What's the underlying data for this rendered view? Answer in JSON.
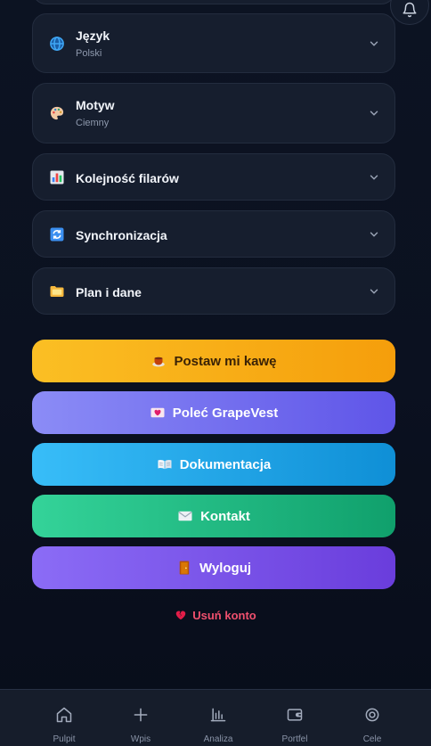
{
  "settings": {
    "language": {
      "title": "Język",
      "value": "Polski"
    },
    "theme": {
      "title": "Motyw",
      "value": "Ciemny"
    },
    "pillar_order": {
      "title": "Kolejność filarów"
    },
    "sync": {
      "title": "Synchronizacja"
    },
    "plan": {
      "title": "Plan i dane"
    }
  },
  "actions": {
    "coffee": "Postaw mi kawę",
    "refer": "Poleć GrapeVest",
    "docs": "Dokumentacja",
    "contact": "Kontakt",
    "logout": "Wyloguj",
    "delete_account": "Usuń konto"
  },
  "nav": {
    "dashboard": "Pulpit",
    "entry": "Wpis",
    "analysis": "Analiza",
    "portfolio": "Portfel",
    "goals": "Cele"
  },
  "colors": {
    "coffee": "#f59e0b",
    "refer": "#6366f1",
    "docs": "#0ea5e9",
    "contact": "#10b981",
    "logout": "#7c3aed",
    "danger": "#f0506e"
  },
  "icons": {
    "language": "globe-icon",
    "theme": "palette-icon",
    "pillar_order": "bar-chart-icon",
    "sync": "sync-icon",
    "plan": "folder-icon",
    "coffee": "coffee-icon",
    "refer": "heart-letter-icon",
    "docs": "book-icon",
    "contact": "envelope-icon",
    "logout": "door-icon",
    "delete": "broken-heart-icon"
  }
}
